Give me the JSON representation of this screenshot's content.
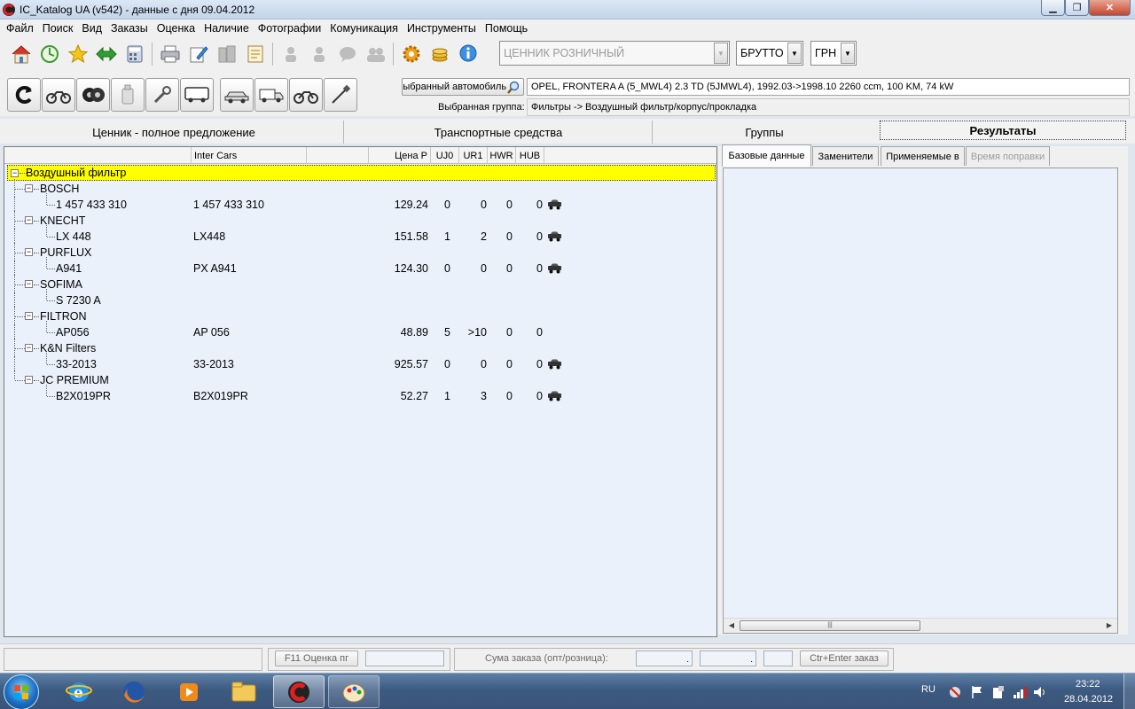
{
  "window": {
    "title": "IC_Katalog UA (v542) - данные с дня 09.04.2012"
  },
  "menu": [
    "Файл",
    "Поиск",
    "Вид",
    "Заказы",
    "Оценка",
    "Наличие",
    "Фотографии",
    "Комуникация",
    "Инструменты",
    "Помощь"
  ],
  "toolbar": {
    "price_list": "ЦЕННИК РОЗНИЧНЫЙ",
    "gross": "БРУТТО",
    "currency": "ГРН",
    "vehicle_button": "Выбранный автомобиль",
    "vehicle_value": "OPEL, FRONTERA A (5_MWL4)  2.3 TD (5JMWL4), 1992.03->1998.10  2260 ccm, 100 KM, 74 kW",
    "group_label": "Выбранная группа:",
    "group_value": "Фильтры -> Воздушный фильтр/корпус/прокладка"
  },
  "main_tabs": [
    "Ценник - полное предложение",
    "Транспортные средства",
    "Группы",
    "Результаты"
  ],
  "tree": {
    "headers": [
      "",
      "Inter Cars",
      "",
      "Цена Р",
      "UJ0",
      "UR1",
      "HWR",
      "HUB"
    ],
    "root": "Воздушный фильтр",
    "brands": [
      {
        "name": "BOSCH",
        "part": "1 457 433 310",
        "ic_code": "1 457 433 310",
        "price": "129.24",
        "uj0": "0",
        "ur1": "0",
        "hwr": "0",
        "hub": "0",
        "has_icon": true
      },
      {
        "name": "KNECHT",
        "part": "LX 448",
        "ic_code": "LX448",
        "price": "151.58",
        "uj0": "1",
        "ur1": "2",
        "hwr": "0",
        "hub": "0",
        "has_icon": true
      },
      {
        "name": "PURFLUX",
        "part": "A941",
        "ic_code": "PX A941",
        "price": "124.30",
        "uj0": "0",
        "ur1": "0",
        "hwr": "0",
        "hub": "0",
        "has_icon": true
      },
      {
        "name": "SOFIMA",
        "part": "S 7230 A",
        "ic_code": "",
        "price": "",
        "uj0": "",
        "ur1": "",
        "hwr": "",
        "hub": "",
        "has_icon": false
      },
      {
        "name": "FILTRON",
        "part": "AP056",
        "ic_code": "AP 056",
        "price": "48.89",
        "uj0": "5",
        "ur1": ">10",
        "hwr": "0",
        "hub": "0",
        "has_icon": false
      },
      {
        "name": "K&N Filters",
        "part": "33-2013",
        "ic_code": "33-2013",
        "price": "925.57",
        "uj0": "0",
        "ur1": "0",
        "hwr": "0",
        "hub": "0",
        "has_icon": true
      },
      {
        "name": "JC PREMIUM",
        "part": "B2X019PR",
        "ic_code": "B2X019PR",
        "price": "52.27",
        "uj0": "1",
        "ur1": "3",
        "hwr": "0",
        "hub": "0",
        "has_icon": true
      }
    ]
  },
  "results_tabs": [
    "Базовые данные",
    "Заменители",
    "Применяемые в",
    "Время поправки"
  ],
  "status": {
    "f11_button": "F11 Оценка пг",
    "order_sum_label": "Сума заказа (опт/розница):",
    "sum_opt": ".",
    "sum_retail": ".",
    "ctrl_enter_button": "Ctr+Enter заказ"
  },
  "taskbar": {
    "lang": "RU",
    "time": "23:22",
    "date": "28.04.2012"
  }
}
